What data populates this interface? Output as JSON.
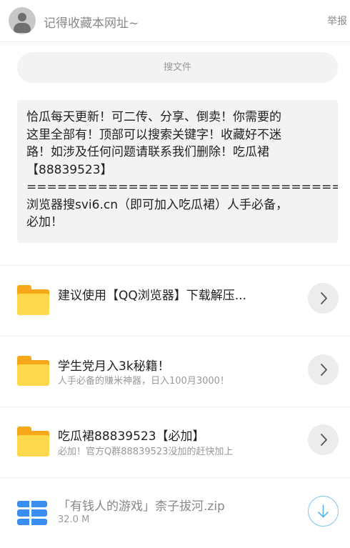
{
  "header": {
    "title": "记得收藏本网址~",
    "report": "举报"
  },
  "search": {
    "placeholder": "搜文件"
  },
  "notice": {
    "text": "恰瓜每天更新！可二传、分享、倒卖！你需要的\n这里全部有！顶部可以搜索关键字！收藏好不迷\n路！如涉及任何问题请联系我们删除！吃瓜裙\n【88839523】\n===========================================\n浏览器搜svi6.cn（即可加入吃瓜裙）人手必备，\n必加！"
  },
  "items": [
    {
      "title": "建议使用【QQ浏览器】下载解压...",
      "subtitle": "",
      "icon": "folder-icon",
      "action": "chevron-right-icon"
    },
    {
      "title": "学生党月入3k秘籍！",
      "subtitle": "人手必备的赚米神器，日入100月3000！",
      "icon": "folder-icon",
      "action": "chevron-right-icon"
    },
    {
      "title": "吃瓜裙88839523【必加】",
      "subtitle": "必加！官方Q群88839523没加的赶快加上",
      "icon": "folder-icon",
      "action": "chevron-right-icon"
    }
  ],
  "file": {
    "name": "「有钱人的游戏」柰子拔河.zip",
    "size": "32.0 M",
    "icon": "zip-file-icon",
    "action": "download-icon"
  },
  "colors": {
    "accent": "#56b4e8",
    "folder": "#ffd94d",
    "zip": "#3a8ef0"
  }
}
